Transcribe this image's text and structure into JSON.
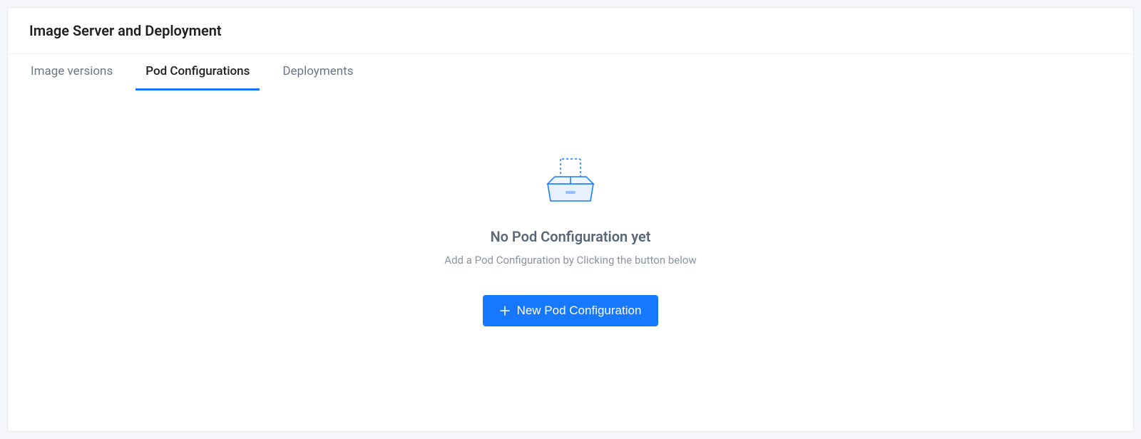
{
  "header": {
    "title": "Image Server and Deployment"
  },
  "tabs": [
    {
      "label": "Image versions",
      "active": false
    },
    {
      "label": "Pod Configurations",
      "active": true
    },
    {
      "label": "Deployments",
      "active": false
    }
  ],
  "empty_state": {
    "title": "No Pod Configuration yet",
    "subtitle": "Add a Pod Configuration by Clicking the button below",
    "button_label": "New Pod Configuration"
  }
}
